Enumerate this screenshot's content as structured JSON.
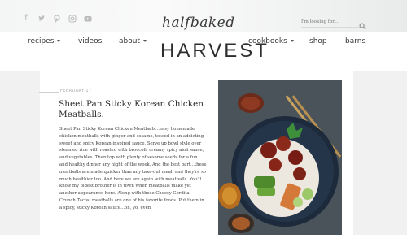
{
  "header": {
    "social_icons": [
      "facebook-icon",
      "twitter-icon",
      "pinterest-icon",
      "instagram-icon",
      "youtube-icon"
    ],
    "search": {
      "placeholder": "I'm looking for..."
    },
    "logo": {
      "line1": "halfbaked",
      "line2": "HARVEST"
    }
  },
  "nav": {
    "recipes": "recipes",
    "videos": "videos",
    "about": "about",
    "cookbooks": "cookbooks",
    "shop": "shop",
    "barns": "barns"
  },
  "post": {
    "date": "FEBRUARY 17",
    "title": "Sheet Pan Sticky Korean Chicken Meatballs.",
    "body": "Sheet Pan Sticky Korean Chicken Meatballs...easy homemade chicken meatballs with ginger and sesame, tossed in an addicting sweet and spicy Korean-inspired sauce. Serve up bowl style over steamed rice with roasted with broccoli, creamy spicy aioli sauce, and vegetables. Then top with plenty of sesame seeds for a fun and healthy dinner any night of the week. And the best part...these meatballs are made quicker than any take-out meal, and they're so much healthier too. And here we are again with meatballs. You'll know my oldest brother is in town when meatballs make yet another appearance here. Along with those Cheesy Gordita Crunch Tacos, meatballs are one of his favorite foods. Put them in a spicy, sticky Korean sauce...oh, yo, even"
  },
  "colors": {
    "accent": "#9e7a4f",
    "text": "#2b2b2b",
    "background": "#f1f1f1"
  }
}
